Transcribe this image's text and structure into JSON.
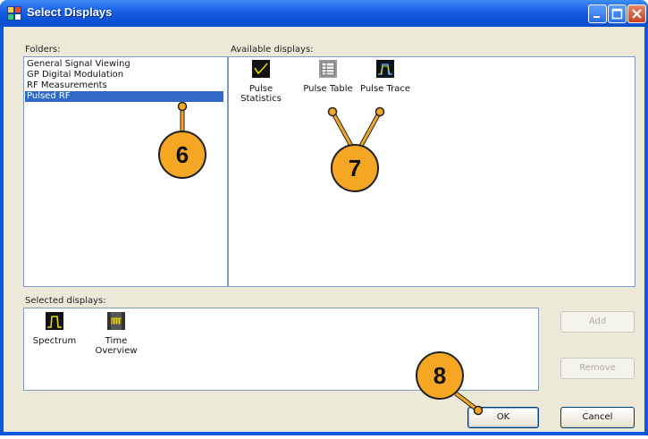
{
  "window": {
    "title": "Select Displays"
  },
  "folders": {
    "label": "Folders:",
    "items": [
      "General Signal Viewing",
      "GP Digital Modulation",
      "RF Measurements",
      "Pulsed RF"
    ],
    "selected_index": 3
  },
  "available": {
    "label": "Available displays:",
    "items": [
      {
        "line1": "Pulse",
        "line2": "Statistics",
        "icon": "pulse-statistics-icon"
      },
      {
        "line1": "Pulse Table",
        "line2": "",
        "icon": "pulse-table-icon"
      },
      {
        "line1": "Pulse Trace",
        "line2": "",
        "icon": "pulse-trace-icon"
      }
    ]
  },
  "selected": {
    "label": "Selected displays:",
    "items": [
      {
        "line1": "Spectrum",
        "line2": "",
        "icon": "spectrum-icon"
      },
      {
        "line1": "Time",
        "line2": "Overview",
        "icon": "time-overview-icon"
      }
    ]
  },
  "buttons": {
    "add": "Add",
    "remove": "Remove",
    "ok": "OK",
    "cancel": "Cancel"
  },
  "callouts": {
    "c6": "6",
    "c7": "7",
    "c8": "8"
  },
  "colors": {
    "accent": "#316ac5",
    "callout": "#f5a623",
    "title_bar": "#0c53d8"
  }
}
